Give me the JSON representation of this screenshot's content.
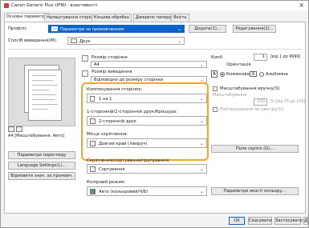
{
  "window": {
    "title": "Canon Generic Plus UFRII - властивості",
    "close": "×"
  },
  "tabs": [
    {
      "label": "Основні параметри"
    },
    {
      "label": "Налаштування сторінки"
    },
    {
      "label": "Кінцева обробка"
    },
    {
      "label": "Джерело паперу"
    },
    {
      "label": "Якість"
    }
  ],
  "profile": {
    "label": "Профілі:",
    "value": "Параметри за промовчанням",
    "add": "Додати(1)...",
    "edit": "Редагування(2)..."
  },
  "output_method": {
    "label": "Спосіб виведення(M):",
    "value": "Друк"
  },
  "page_size": {
    "label": "Розмір сторінки",
    "value": "A4"
  },
  "output_size": {
    "label": "Розмір виведення",
    "value": "Відповідно до розміру сторінки"
  },
  "copies": {
    "label": "Копії:",
    "value": "1",
    "range": "[від 1 до 9999]"
  },
  "orientation": {
    "label": "Орієнтація",
    "portrait": "Книжкова",
    "landscape": "Альбомна"
  },
  "page_layout": {
    "label": "Компонування сторінок:",
    "value": "1 на 1"
  },
  "manual_scaling": {
    "label": "Масштабування вручну(S)",
    "sublabel": "Масштабування",
    "value": "100",
    "range": "% [від 25 до 200]"
  },
  "duplex": {
    "label": "1-сторонній/2-сторонній друк/брошура:",
    "value": "2-сторонній друк"
  },
  "center_print": {
    "label": "Розташування по центру(U)"
  },
  "binding": {
    "label": "Місце скріплення:",
    "value": "Довгий край (ліворуч)"
  },
  "binding_button": "Поле скріпл.(G)...",
  "collate": {
    "label": "Скріплення/сортування/групування:",
    "value": "Сортування"
  },
  "color_mode": {
    "label": "Колірний режим",
    "value": "Авто (кольоровий/Ч/Б)"
  },
  "color_quality_button": "Параметри якості кольору...",
  "preview_caption": "A4 [Масштабування: Авто]",
  "left_buttons": [
    "Параметри перегляду",
    "Language Settings(L)...",
    "Відновити знач. за промовч."
  ],
  "footer": {
    "ok": "OK",
    "cancel": "Скасувати",
    "apply": "Застосувати",
    "help": "Довідка"
  }
}
